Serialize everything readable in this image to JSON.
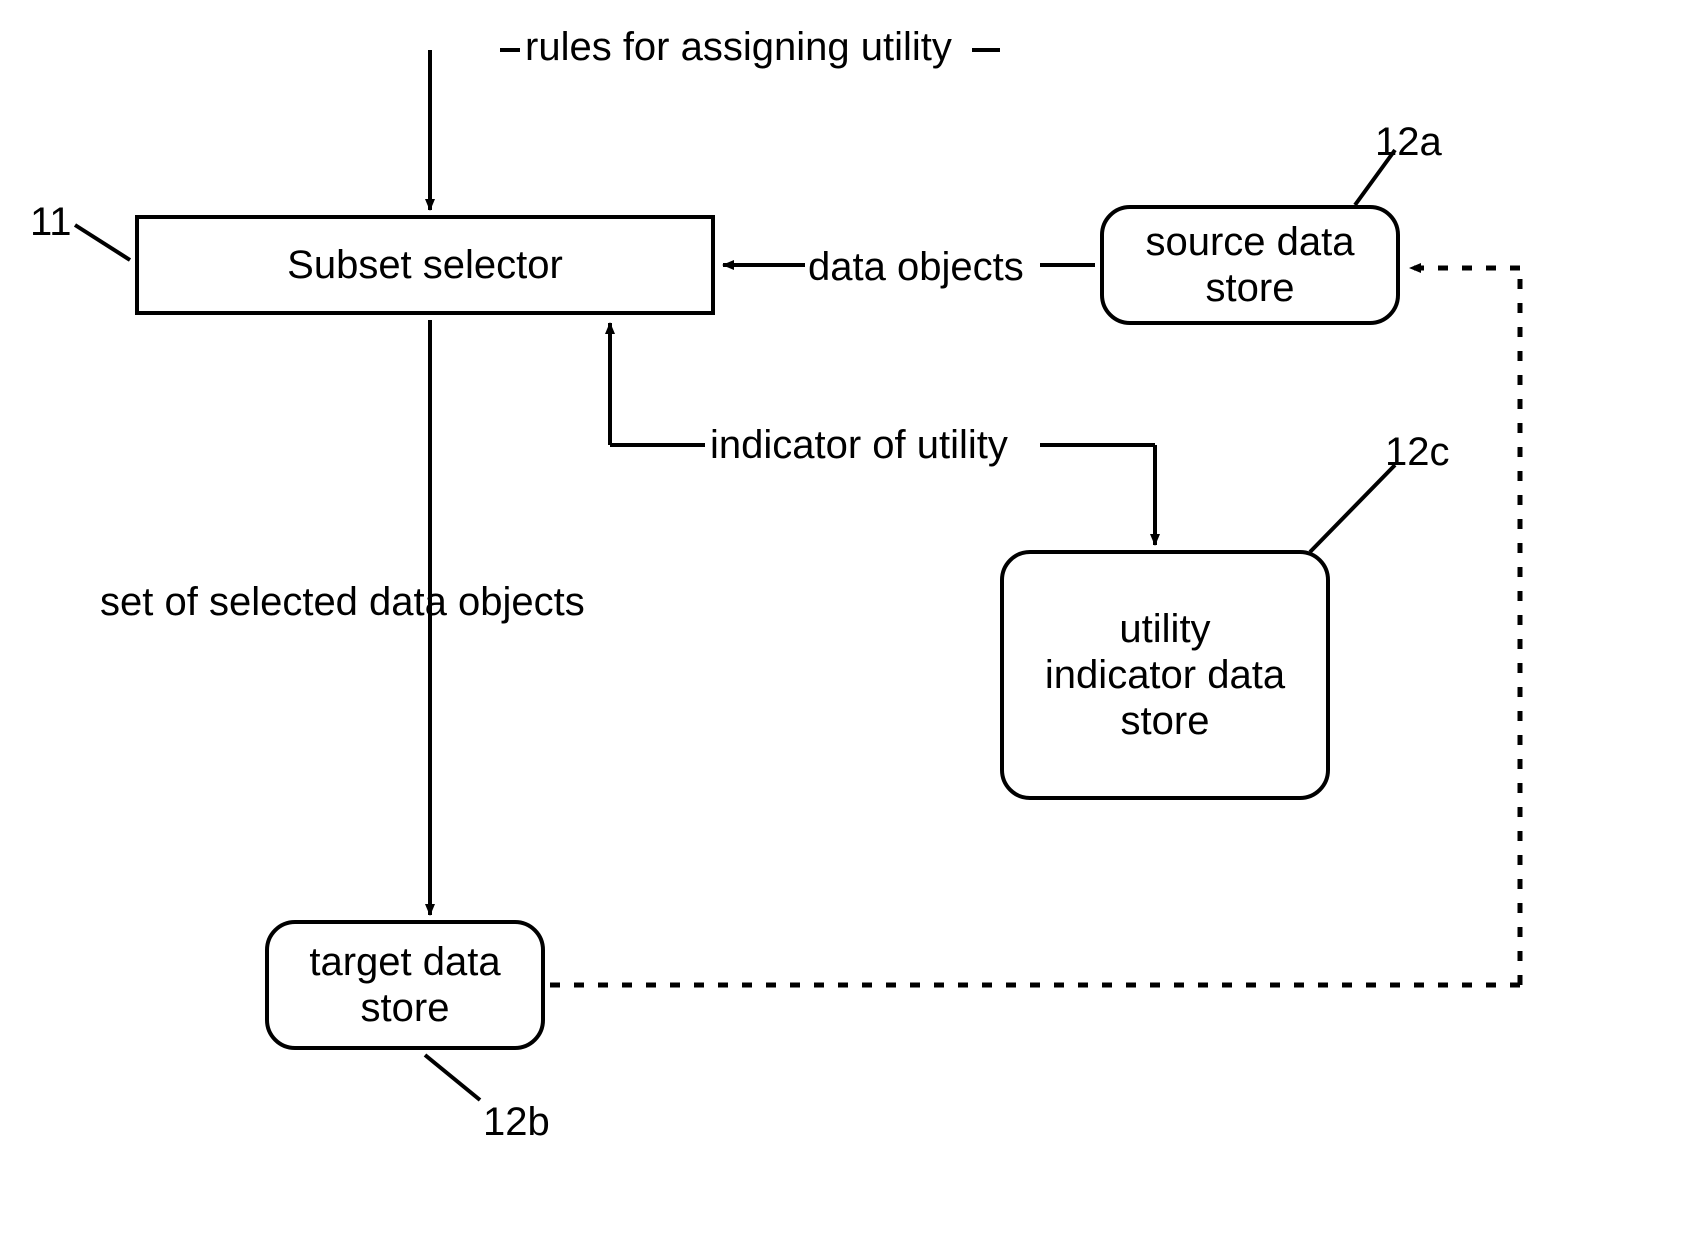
{
  "boxes": {
    "subsetSelector": "Subset selector",
    "sourceDataStore": "source data\nstore",
    "utilityIndicator": "utility\nindicator data\nstore",
    "targetDataStore": "target data\nstore"
  },
  "labels": {
    "rulesAssigning": "rules for assigning utility",
    "dataObjects": "data objects",
    "indicatorOfUtility": "indicator of utility",
    "setSelected": "set of selected data objects"
  },
  "refs": {
    "r11": "11",
    "r12a": "12a",
    "r12b": "12b",
    "r12c": "12c"
  }
}
